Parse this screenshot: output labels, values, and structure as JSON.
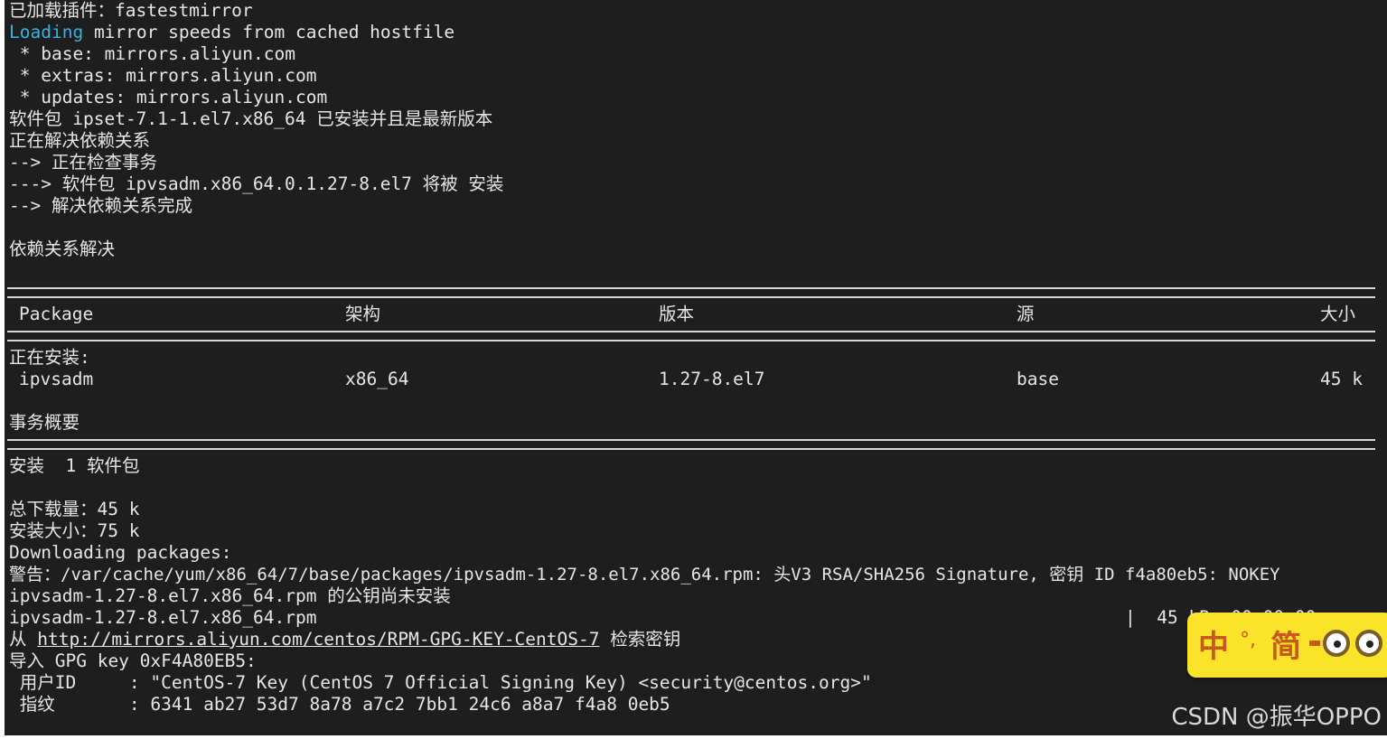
{
  "terminal": {
    "lines": [
      "已加载插件：fastestmirror",
      "mirror speeds from cached hostfile",
      " * base: mirrors.aliyun.com",
      " * extras: mirrors.aliyun.com",
      " * updates: mirrors.aliyun.com",
      "软件包 ipset-7.1-1.el7.x86_64 已安装并且是最新版本",
      "正在解决依赖关系",
      "--> 正在检查事务",
      "---> 软件包 ipvsadm.x86_64.0.1.27-8.el7 将被 安装",
      "--> 解决依赖关系完成",
      "依赖关系解决",
      "正在安装:",
      "事务概要",
      "安装  1 软件包",
      "总下载量：45 k",
      "安装大小：75 k",
      "Downloading packages:",
      "警告：/var/cache/yum/x86_64/7/base/packages/ipvsadm-1.27-8.el7.x86_64.rpm: 头V3 RSA/SHA256 Signature, 密钥 ID f4a80eb5: NOKEY",
      "ipvsadm-1.27-8.el7.x86_64.rpm 的公钥尚未安装",
      "ipvsadm-1.27-8.el7.x86_64.rpm",
      "|  45 kB  00:00:00",
      "从 ",
      "http://mirrors.aliyun.com/centos/RPM-GPG-KEY-CentOS-7",
      " 检索密钥",
      "导入 GPG key 0xF4A80EB5:",
      " 用户ID     : \"CentOS-7 Key (CentOS 7 Official Signing Key) <security@centos.org>\"",
      " 指纹       : 6341 ab27 53d7 8a78 a7c2 7bb1 24c6 a8a7 f4a8 0eb5"
    ],
    "loading_word": "Loading",
    "table": {
      "headers": [
        "Package",
        "架构",
        "版本",
        "源",
        "大小"
      ],
      "rows": [
        [
          "ipvsadm",
          "x86_64",
          "1.27-8.el7",
          "base",
          "45 k"
        ]
      ]
    }
  },
  "ime": {
    "lang": "中",
    "punct": "°,",
    "mode": "简"
  },
  "watermark": "CSDN @振华OPPO",
  "colors": {
    "terminal_bg": "#1e1e1e",
    "text": "#e6e6e6",
    "loading": "#36b3e0",
    "ime_bg": "#fbe32a"
  }
}
